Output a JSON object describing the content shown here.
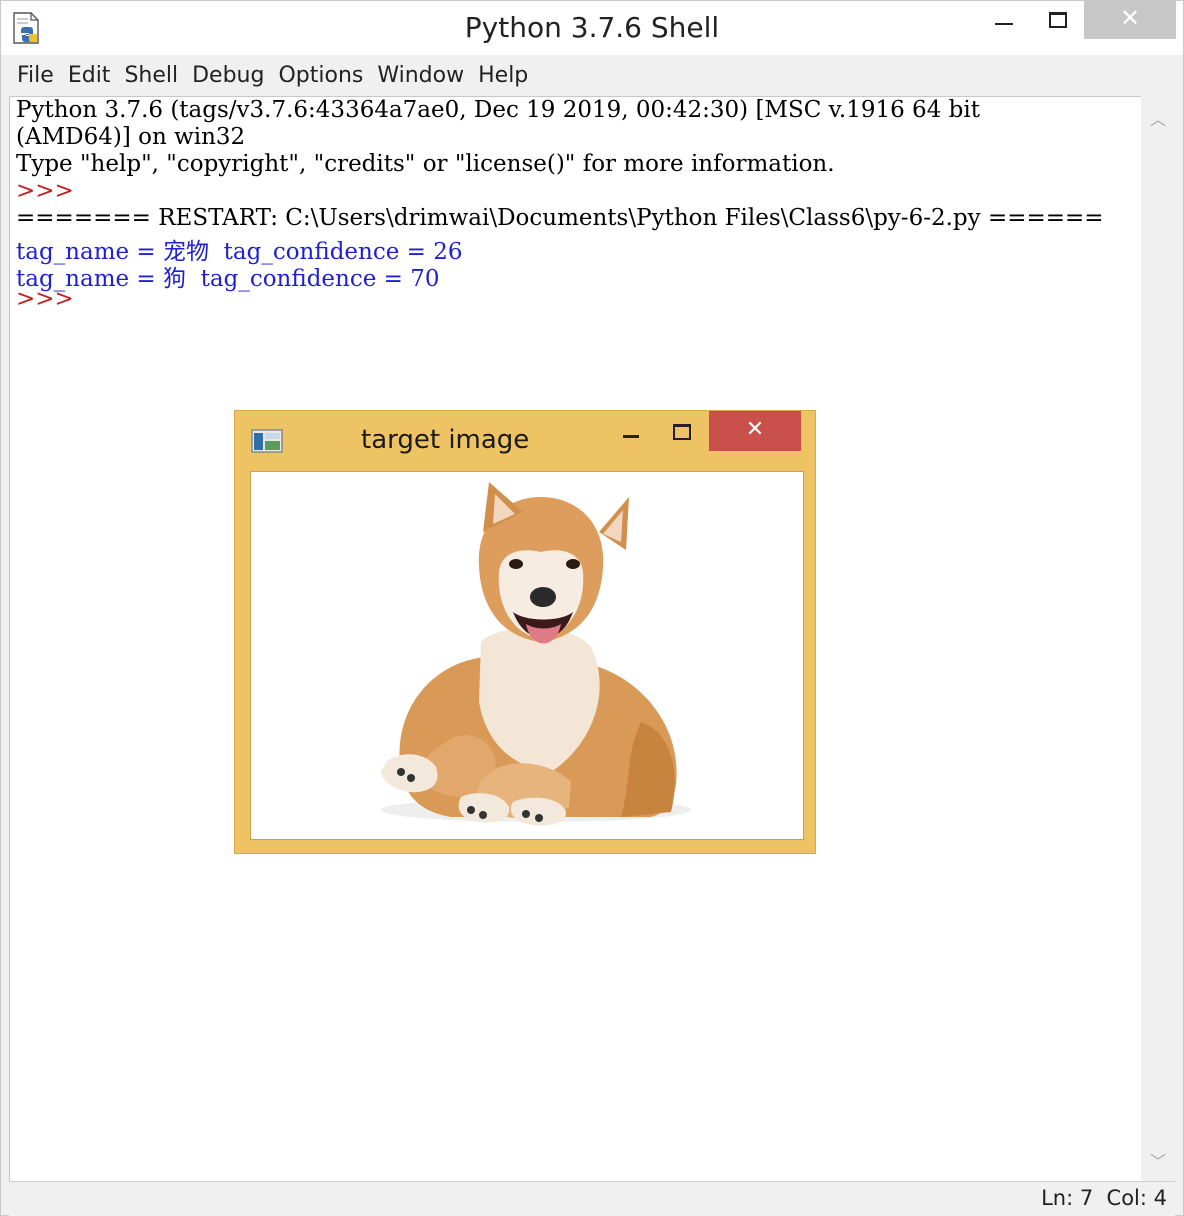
{
  "window": {
    "title": "Python 3.7.6 Shell",
    "close_glyph": "✕"
  },
  "menu": [
    "File",
    "Edit",
    "Shell",
    "Debug",
    "Options",
    "Window",
    "Help"
  ],
  "shell_lines": [
    {
      "text": "Python 3.7.6 (tags/v3.7.6:43364a7ae0, Dec 19 2019, 00:42:30) [MSC v.1916 64 bit",
      "style": "normal"
    },
    {
      "text": "(AMD64)] on win32",
      "style": "normal"
    },
    {
      "text": "Type \"help\", \"copyright\", \"credits\" or \"license()\" for more information.",
      "style": "normal"
    },
    {
      "text": ">>>",
      "style": "prompt"
    },
    {
      "text": "======= RESTART: C:\\Users\\drimwai\\Documents\\Python Files\\Class6\\py-6-2.py ======",
      "style": "normal"
    },
    {
      "text": "tag_name = 宠物  tag_confidence = 26",
      "style": "out"
    },
    {
      "text": "tag_name = 狗  tag_confidence = 70",
      "style": "out"
    },
    {
      "text": ">>>",
      "style": "prompt"
    }
  ],
  "status": {
    "text": "Ln: 7  Col: 4"
  },
  "scroll": {
    "up": "︿",
    "down": "﹀"
  },
  "target_window": {
    "title": "target image",
    "close_glyph": "✕",
    "image_subject": "shiba-inu-dog-photo"
  },
  "colors": {
    "prompt": "#c02020",
    "output": "#1f1fd6",
    "target_frame": "#eec363",
    "target_close": "#c9504a"
  }
}
